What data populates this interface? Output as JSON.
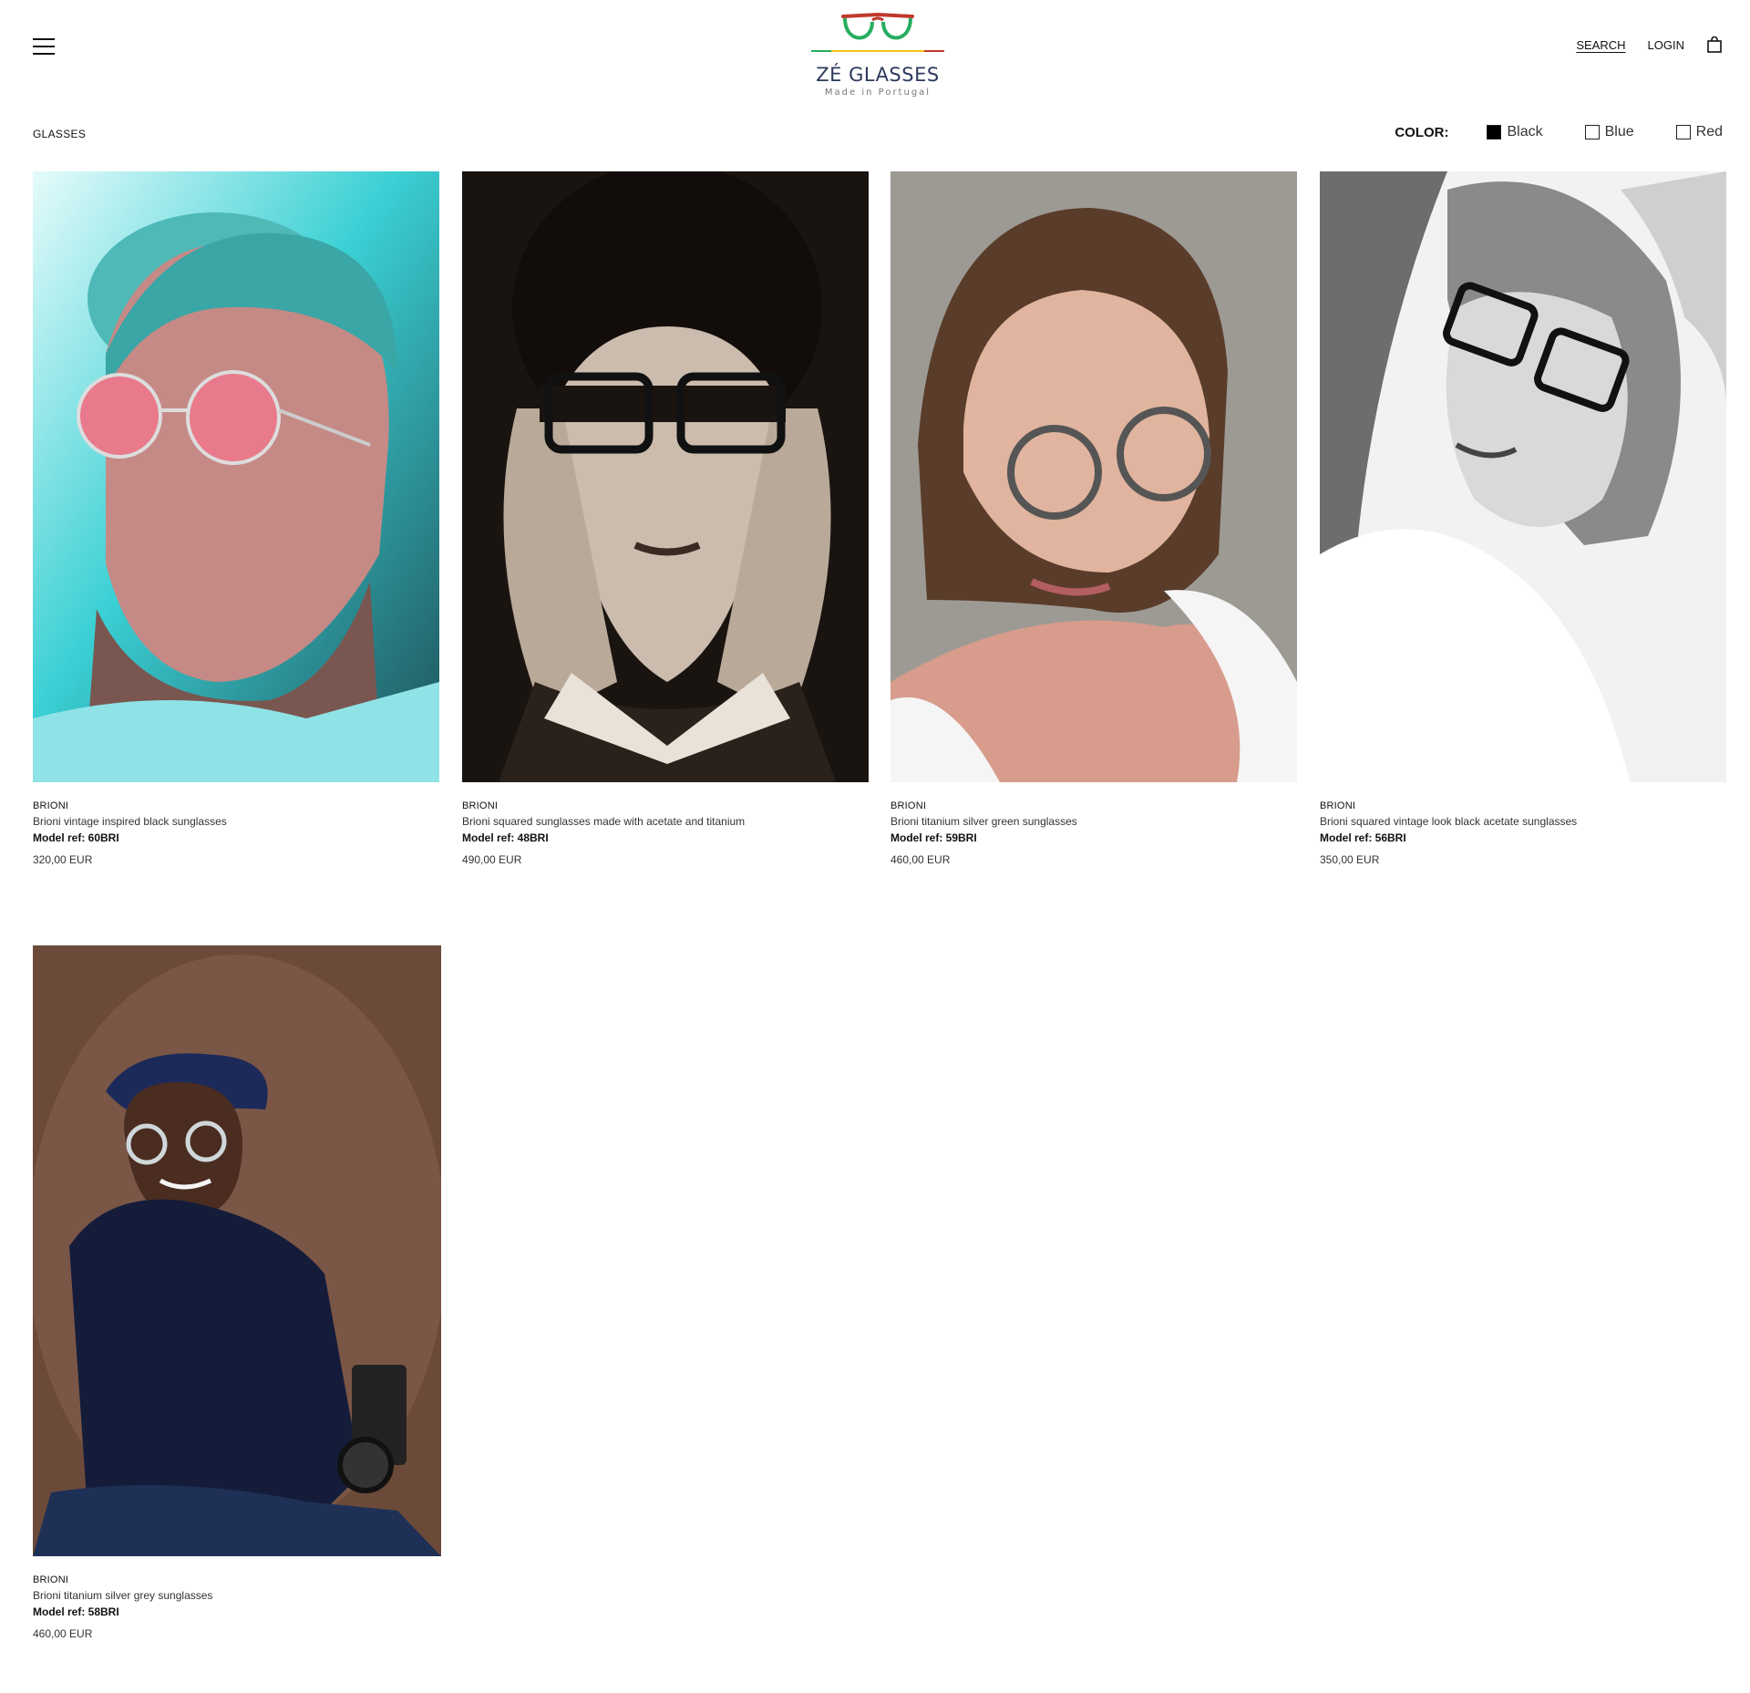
{
  "header": {
    "menu_icon": "hamburger-menu-icon",
    "logo": {
      "name": "ZÉ GLASSES",
      "tagline": "Made in Portugal",
      "colors": {
        "red": "#c0392b",
        "green": "#27ae60",
        "yellow": "#f1c40f",
        "navy": "#2c3a5c"
      }
    },
    "search_label": "SEARCH",
    "login_label": "LOGIN",
    "cart_icon": "shopping-bag-icon"
  },
  "breadcrumb": "GLASSES",
  "filters": {
    "label": "COLOR:",
    "options": [
      {
        "label": "Black",
        "checked": true
      },
      {
        "label": "Blue",
        "checked": false
      },
      {
        "label": "Red",
        "checked": false
      }
    ]
  },
  "products": [
    {
      "brand": "BRIONI",
      "title": "Brioni vintage inspired black sunglasses",
      "ref": "Model ref: 60BRI",
      "price": "320,00 EUR"
    },
    {
      "brand": "BRIONI",
      "title": "Brioni squared sunglasses made with acetate and titanium",
      "ref": "Model ref: 48BRI",
      "price": "490,00 EUR"
    },
    {
      "brand": "BRIONI",
      "title": "Brioni titanium silver green sunglasses",
      "ref": "Model ref: 59BRI",
      "price": "460,00 EUR"
    },
    {
      "brand": "BRIONI",
      "title": "Brioni squared vintage look black acetate sunglasses",
      "ref": "Model ref: 56BRI",
      "price": "350,00 EUR"
    },
    {
      "brand": "BRIONI",
      "title": "Brioni titanium silver grey sunglasses",
      "ref": "Model ref: 58BRI",
      "price": "460,00 EUR"
    }
  ]
}
